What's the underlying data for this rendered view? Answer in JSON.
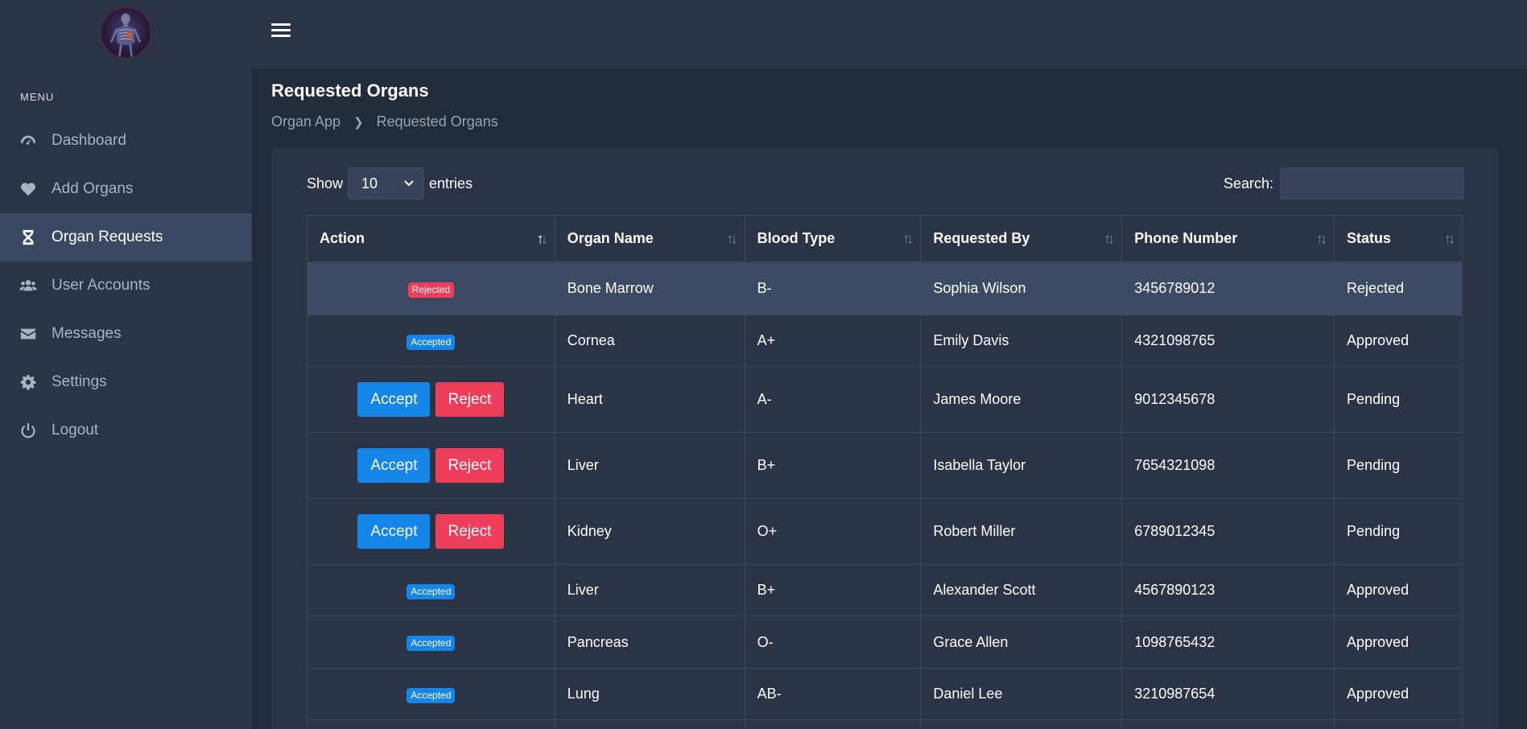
{
  "sidebar": {
    "menu_label": "MENU",
    "items": [
      {
        "label": "Dashboard",
        "icon": "tachometer-icon",
        "active": false
      },
      {
        "label": "Add Organs",
        "icon": "heart-icon",
        "active": false
      },
      {
        "label": "Organ Requests",
        "icon": "hourglass-icon",
        "active": true
      },
      {
        "label": "User Accounts",
        "icon": "users-icon",
        "active": false
      },
      {
        "label": "Messages",
        "icon": "envelope-icon",
        "active": false
      },
      {
        "label": "Settings",
        "icon": "gear-icon",
        "active": false
      },
      {
        "label": "Logout",
        "icon": "power-icon",
        "active": false
      }
    ]
  },
  "page": {
    "title": "Requested Organs",
    "breadcrumb": [
      "Organ App",
      "Requested Organs"
    ]
  },
  "controls": {
    "show_label": "Show",
    "entries_value": "10",
    "entries_label": "entries",
    "search_label": "Search:",
    "search_value": ""
  },
  "table": {
    "headers": [
      "Action",
      "Organ Name",
      "Blood Type",
      "Requested By",
      "Phone Number",
      "Status"
    ],
    "accept_label": "Accept",
    "reject_label": "Reject",
    "rows": [
      {
        "action": "Rejected",
        "organ": "Bone Marrow",
        "blood": "B-",
        "requested_by": "Sophia Wilson",
        "phone": "3456789012",
        "status": "Rejected"
      },
      {
        "action": "Accepted",
        "organ": "Cornea",
        "blood": "A+",
        "requested_by": "Emily Davis",
        "phone": "4321098765",
        "status": "Approved"
      },
      {
        "action": "buttons",
        "organ": "Heart",
        "blood": "A-",
        "requested_by": "James Moore",
        "phone": "9012345678",
        "status": "Pending"
      },
      {
        "action": "buttons",
        "organ": "Liver",
        "blood": "B+",
        "requested_by": "Isabella Taylor",
        "phone": "7654321098",
        "status": "Pending"
      },
      {
        "action": "buttons",
        "organ": "Kidney",
        "blood": "O+",
        "requested_by": "Robert Miller",
        "phone": "6789012345",
        "status": "Pending"
      },
      {
        "action": "Accepted",
        "organ": "Liver",
        "blood": "B+",
        "requested_by": "Alexander Scott",
        "phone": "4567890123",
        "status": "Approved"
      },
      {
        "action": "Accepted",
        "organ": "Pancreas",
        "blood": "O-",
        "requested_by": "Grace Allen",
        "phone": "1098765432",
        "status": "Approved"
      },
      {
        "action": "Accepted",
        "organ": "Lung",
        "blood": "AB-",
        "requested_by": "Daniel Lee",
        "phone": "3210987654",
        "status": "Approved"
      }
    ]
  },
  "colors": {
    "accent_blue": "#1585e8",
    "danger_red": "#ef3e5c",
    "sidebar_bg": "#2a3446",
    "body_bg": "#222b3c"
  }
}
